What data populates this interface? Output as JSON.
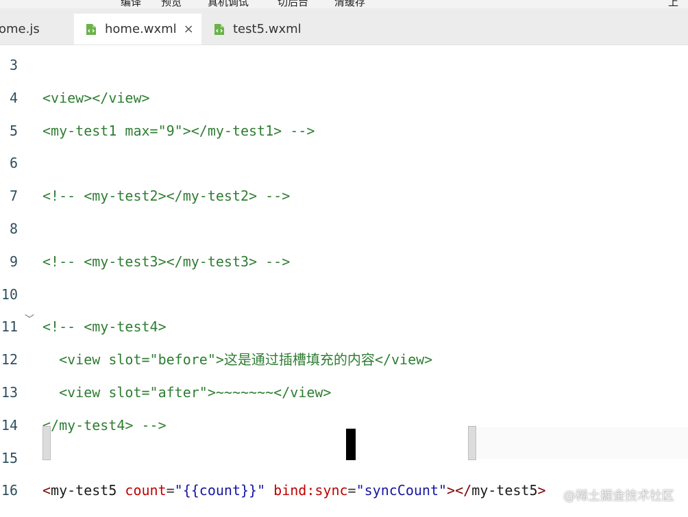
{
  "toolbar": {
    "items": [
      "编译",
      "预览",
      "真机调试",
      "切后台",
      "清缓存"
    ],
    "right_label": "上传"
  },
  "tabs": [
    {
      "label": "ome.js",
      "active": false
    },
    {
      "label": "home.wxml",
      "active": true,
      "close": "×"
    },
    {
      "label": "test5.wxml",
      "active": false
    }
  ],
  "editor": {
    "lines": [
      {
        "number": "3",
        "tokens": []
      },
      {
        "number": "4",
        "tokens": [
          {
            "t": "<view></view>",
            "c": "comment"
          }
        ]
      },
      {
        "number": "5",
        "tokens": [
          {
            "t": "<my-test1 max=\"9\"></my-test1> -->",
            "c": "comment"
          }
        ]
      },
      {
        "number": "6",
        "tokens": []
      },
      {
        "number": "7",
        "tokens": [
          {
            "t": "<!-- <my-test2></my-test2> -->",
            "c": "comment"
          }
        ]
      },
      {
        "number": "8",
        "tokens": []
      },
      {
        "number": "9",
        "tokens": [
          {
            "t": "<!-- <my-test3></my-test3> -->",
            "c": "comment"
          }
        ]
      },
      {
        "number": "10",
        "tokens": []
      },
      {
        "number": "11",
        "fold": true,
        "tokens": [
          {
            "t": "<!-- <my-test4>",
            "c": "comment"
          }
        ]
      },
      {
        "number": "12",
        "tokens": [
          {
            "t": "  <view slot=\"before\">这是通过插槽填充的内容</view>",
            "c": "comment"
          }
        ]
      },
      {
        "number": "13",
        "tokens": [
          {
            "t": "  <view slot=\"after\">~~~~~~~</view>",
            "c": "comment"
          }
        ]
      },
      {
        "number": "14",
        "tokens": [
          {
            "t": "</my-test4> -->",
            "c": "comment"
          }
        ]
      },
      {
        "number": "15",
        "tokens": []
      },
      {
        "number": "16",
        "tokens": [
          {
            "t": "<",
            "c": "tag"
          },
          {
            "t": "my-test5",
            "c": "text"
          },
          {
            "t": " count",
            "c": "attr"
          },
          {
            "t": "=",
            "c": "op"
          },
          {
            "t": "\"{{count}}\"",
            "c": "val"
          },
          {
            "t": " bind:sync",
            "c": "attr"
          },
          {
            "t": "=",
            "c": "op"
          },
          {
            "t": "\"syncCount\"",
            "c": "val"
          },
          {
            "t": ">",
            "c": "tag"
          },
          {
            "t": "</",
            "c": "tag"
          },
          {
            "t": "my-test5",
            "c": "text"
          },
          {
            "t": ">",
            "c": "tag"
          }
        ]
      }
    ]
  },
  "watermark": "@稀土掘金技术社区",
  "fold_glyph": "﹀",
  "icons": {
    "tab_file": "wxml-file-icon",
    "close": "close-icon",
    "fold": "chevron-down-icon"
  },
  "colors": {
    "comment": "#2e7d32",
    "tag": "#800000",
    "attr": "#c00000",
    "value": "#1515a3",
    "line_number": "#2f4f5f"
  }
}
